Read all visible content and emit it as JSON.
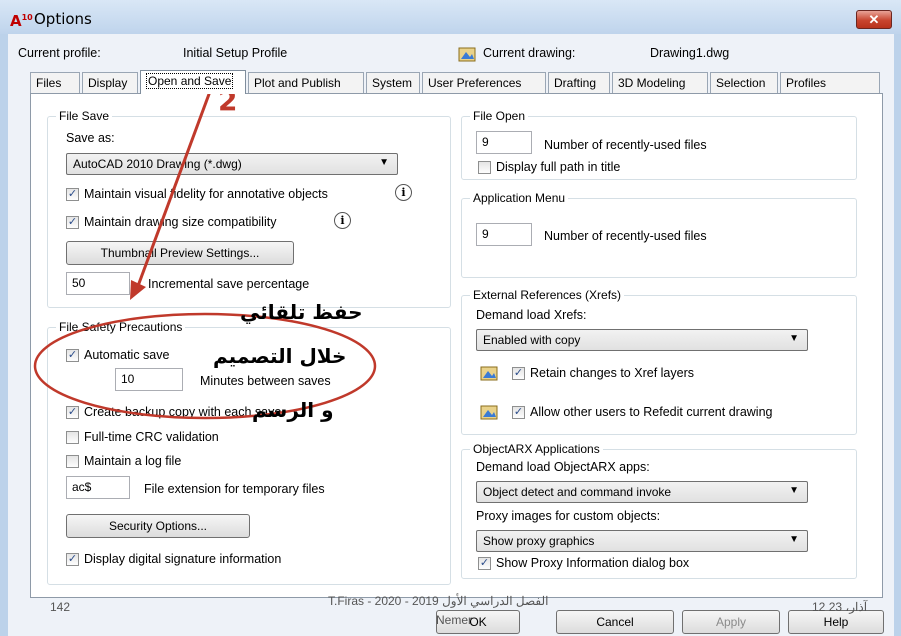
{
  "window": {
    "title": "Options",
    "app_icon_label": "A",
    "app_icon_sup": "10",
    "close_glyph": "✕"
  },
  "header": {
    "current_profile_label": "Current profile:",
    "current_profile_value": "Initial Setup Profile",
    "current_drawing_label": "Current drawing:",
    "current_drawing_value": "Drawing1.dwg"
  },
  "tabs": [
    "Files",
    "Display",
    "Open and Save",
    "Plot and Publish",
    "System",
    "User Preferences",
    "Drafting",
    "3D Modeling",
    "Selection",
    "Profiles"
  ],
  "file_save": {
    "title": "File Save",
    "save_as_label": "Save as:",
    "save_as_value": "AutoCAD 2010 Drawing (*.dwg)",
    "maintain_fidelity": "Maintain visual fidelity for annotative objects",
    "maintain_size": "Maintain drawing size compatibility",
    "thumbnail_button": "Thumbnail Preview Settings...",
    "incremental_value": "50",
    "incremental_label": "Incremental save percentage"
  },
  "safety": {
    "title": "File Safety Precautions",
    "automatic_save": "Automatic save",
    "minutes_value": "10",
    "minutes_label": "Minutes between saves",
    "backup_copy": "Create backup copy with each save",
    "crc_validation": "Full-time CRC validation",
    "log_file": "Maintain a log file",
    "ext_value": "ac$",
    "ext_label": "File extension for temporary files",
    "security_button": "Security Options...",
    "digital_signature": "Display digital signature information"
  },
  "file_open": {
    "title": "File Open",
    "recent_value": "9",
    "recent_label": "Number of recently-used files",
    "full_path": "Display full path in title"
  },
  "app_menu": {
    "title": "Application Menu",
    "recent_value": "9",
    "recent_label": "Number of recently-used files"
  },
  "xrefs": {
    "title": "External References (Xrefs)",
    "demand_label": "Demand load Xrefs:",
    "demand_value": "Enabled with copy",
    "retain_changes": "Retain changes to Xref layers",
    "allow_refedit": "Allow other users to Refedit current drawing"
  },
  "objectarx": {
    "title": "ObjectARX Applications",
    "demand_label": "Demand load ObjectARX apps:",
    "demand_value": "Object detect and command invoke",
    "proxy_label": "Proxy images for custom objects:",
    "proxy_value": "Show proxy graphics",
    "show_proxy_info": "Show Proxy Information dialog box"
  },
  "buttons": {
    "ok": "OK",
    "cancel": "Cancel",
    "apply": "Apply",
    "help": "Help"
  },
  "annotations": {
    "step_number": "2",
    "arabic_line1": "حفظ تلقائي",
    "arabic_line2": "خلال التصميم",
    "arabic_line3": "و الرسم"
  },
  "footer": {
    "page_number": "142",
    "course": "T.Firas  -  2020 - الفصل الدراسي الأول 2019",
    "author": "Nemer",
    "date": "12 آذار، 23"
  },
  "colors": {
    "annotation_red": "#c0392b",
    "accent_blue": "#2b4c8a"
  }
}
